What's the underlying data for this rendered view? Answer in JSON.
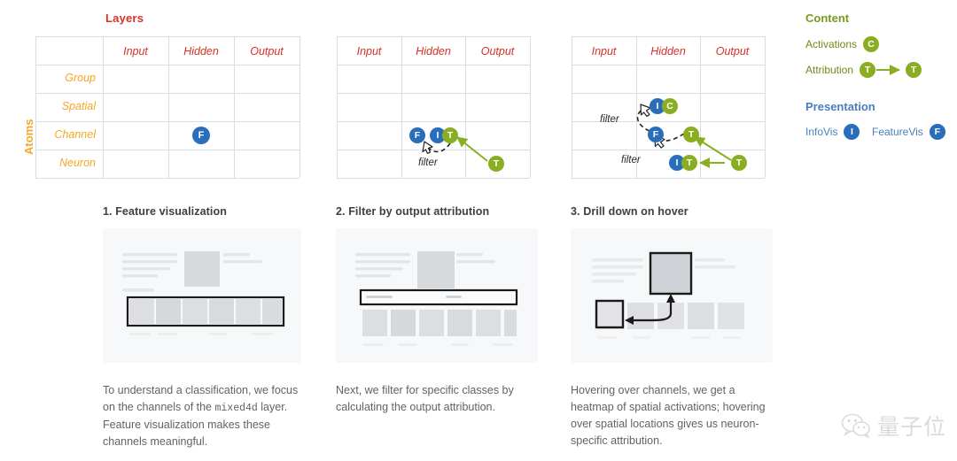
{
  "axes": {
    "layers_title": "Layers",
    "atoms_title": "Atoms",
    "columns": [
      "Input",
      "Hidden",
      "Output"
    ],
    "rows": [
      "Group",
      "Spatial",
      "Channel",
      "Neuron"
    ]
  },
  "colors": {
    "layers_red": "#d93025",
    "atoms_orange": "#f5a623",
    "blue": "#2a6ebb",
    "green": "#8aae21",
    "content_heading": "#7a9a1e",
    "presentation_heading": "#4a7dbd",
    "grid": "#d8dce3"
  },
  "matrix1": {
    "nodes": [
      {
        "letter": "F",
        "color": "blue",
        "row": "Channel",
        "column": "Hidden"
      }
    ],
    "filter_labels": []
  },
  "matrix2": {
    "nodes": [
      {
        "letter": "F",
        "color": "blue",
        "row": "Channel",
        "column": "Hidden"
      },
      {
        "letter": "I",
        "color": "blue",
        "row": "Channel",
        "column": "Hidden"
      },
      {
        "letter": "T",
        "color": "green",
        "row": "Channel",
        "column": "Hidden"
      },
      {
        "letter": "T",
        "color": "green",
        "row": "Neuron",
        "column": "Output"
      }
    ],
    "filter_labels": [
      "filter"
    ]
  },
  "matrix3": {
    "nodes": [
      {
        "letter": "I",
        "color": "blue",
        "row": "Spatial",
        "column": "Hidden"
      },
      {
        "letter": "C",
        "color": "green",
        "row": "Spatial",
        "column": "Hidden"
      },
      {
        "letter": "F",
        "color": "blue",
        "row": "Channel",
        "column": "Hidden"
      },
      {
        "letter": "T",
        "color": "green",
        "row": "Channel",
        "column": "Output"
      },
      {
        "letter": "I",
        "color": "blue",
        "row": "Neuron",
        "column": "Hidden"
      },
      {
        "letter": "T",
        "color": "green",
        "row": "Neuron",
        "column": "Hidden"
      },
      {
        "letter": "T",
        "color": "green",
        "row": "Neuron",
        "column": "Output"
      }
    ],
    "filter_labels": [
      "filter",
      "filter"
    ]
  },
  "legend": {
    "content_heading": "Content",
    "presentation_heading": "Presentation",
    "activations_label": "Activations",
    "activations_badge": "C",
    "attribution_label": "Attribution",
    "attribution_badge_from": "T",
    "attribution_badge_to": "T",
    "infovis_label": "InfoVis",
    "infovis_badge": "I",
    "featurevis_label": "FeatureVis",
    "featurevis_badge": "F"
  },
  "panels": [
    {
      "title": "1. Feature visualization",
      "body_pre": "To understand a classification, we focus on the channels of the ",
      "body_mono": "mixed4d",
      "body_post": " layer. Feature visualization makes these channels meaningful.",
      "mock": "feature-visualization-mock"
    },
    {
      "title": "2. Filter by output attribution",
      "body_pre": "Next, we filter for specific classes by calculating the output attribution.",
      "body_mono": "",
      "body_post": "",
      "mock": "filter-attribution-mock"
    },
    {
      "title": "3. Drill down on hover",
      "body_pre": "Hovering over channels, we get a heatmap of spatial activations; hovering over spatial locations gives us neuron-specific attribution.",
      "body_mono": "",
      "body_post": "",
      "mock": "drill-down-mock"
    }
  ],
  "watermark": {
    "text": "量子位",
    "icon": "wechat-icon"
  }
}
